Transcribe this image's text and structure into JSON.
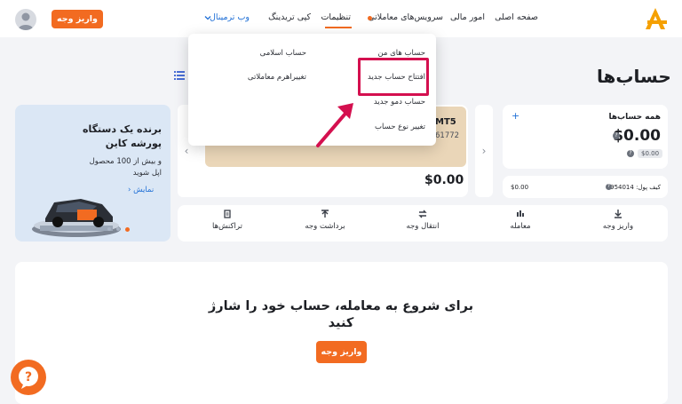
{
  "header": {
    "logo_letter": "A",
    "nav": [
      {
        "label": "صفحه اصلی"
      },
      {
        "label": "امور مالی"
      },
      {
        "label": "سرویس‌های معاملاتی"
      },
      {
        "label": "تنظیمات"
      },
      {
        "label": "کپی تریدینگ"
      },
      {
        "label": "وب ترمینال"
      }
    ],
    "deposit_label": "واریز وجه"
  },
  "page": {
    "title": "حساب‌ها"
  },
  "dropdown": {
    "items": [
      {
        "label": "حساب های من"
      },
      {
        "label": "حساب اسلامی"
      },
      {
        "label": "افتتاح حساب جدید"
      },
      {
        "label": "تغییراهرم معاملاتی"
      },
      {
        "label": "حساب دمو جدید"
      },
      {
        "label": "تغییر نوع حساب"
      }
    ]
  },
  "accounts": {
    "title": "همه حساب‌ها",
    "total": "$0.00",
    "badge": "$0.00",
    "wallet_label": "کیف پول: 2954014",
    "wallet_value": "$0.00"
  },
  "mt5": {
    "label": "MT5",
    "number_partial": "61772",
    "balance": "$0.00"
  },
  "banner": {
    "title_line1": "برنده یک دستگاه",
    "title_line2": "پورشه کاین",
    "sub_line1": "و بیش از 100 محصول",
    "sub_line2": "اپل شوید",
    "link": "نمایش"
  },
  "actions": [
    {
      "label": "واریز وجه"
    },
    {
      "label": "معامله"
    },
    {
      "label": "انتقال وجه"
    },
    {
      "label": "برداشت وجه"
    },
    {
      "label": "تراکنش‌ها"
    }
  ],
  "cta": {
    "title_line1": "برای شروع به معامله، حساب خود را شارژ",
    "title_line2": "کنید",
    "button": "واریز وجه"
  },
  "colors": {
    "accent": "#f26b21",
    "highlight": "#d4104f",
    "link": "#1f6fd6"
  }
}
